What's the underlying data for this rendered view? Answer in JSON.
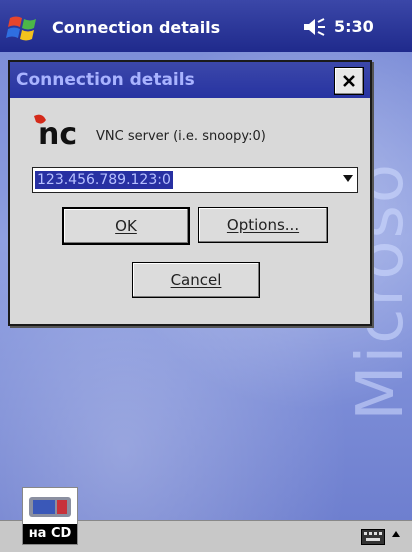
{
  "app": {
    "title": "Connection details",
    "time": "5:30"
  },
  "desktop": {
    "watermark": "Microso"
  },
  "dialog": {
    "title": "Connection details",
    "logo_text": "nc",
    "server_label": "VNC server (i.e. snoopy:0)",
    "server_value": "123.456.789.123:0",
    "ok_label": "OK",
    "options_label": "Options...",
    "cancel_label": "Cancel"
  },
  "badge": {
    "text": "на CD"
  },
  "icons": {
    "start": "windows-flag-icon",
    "speaker": "speaker-icon",
    "close": "close-icon",
    "keyboard": "keyboard-icon",
    "input_arrow": "up-arrow-icon"
  }
}
